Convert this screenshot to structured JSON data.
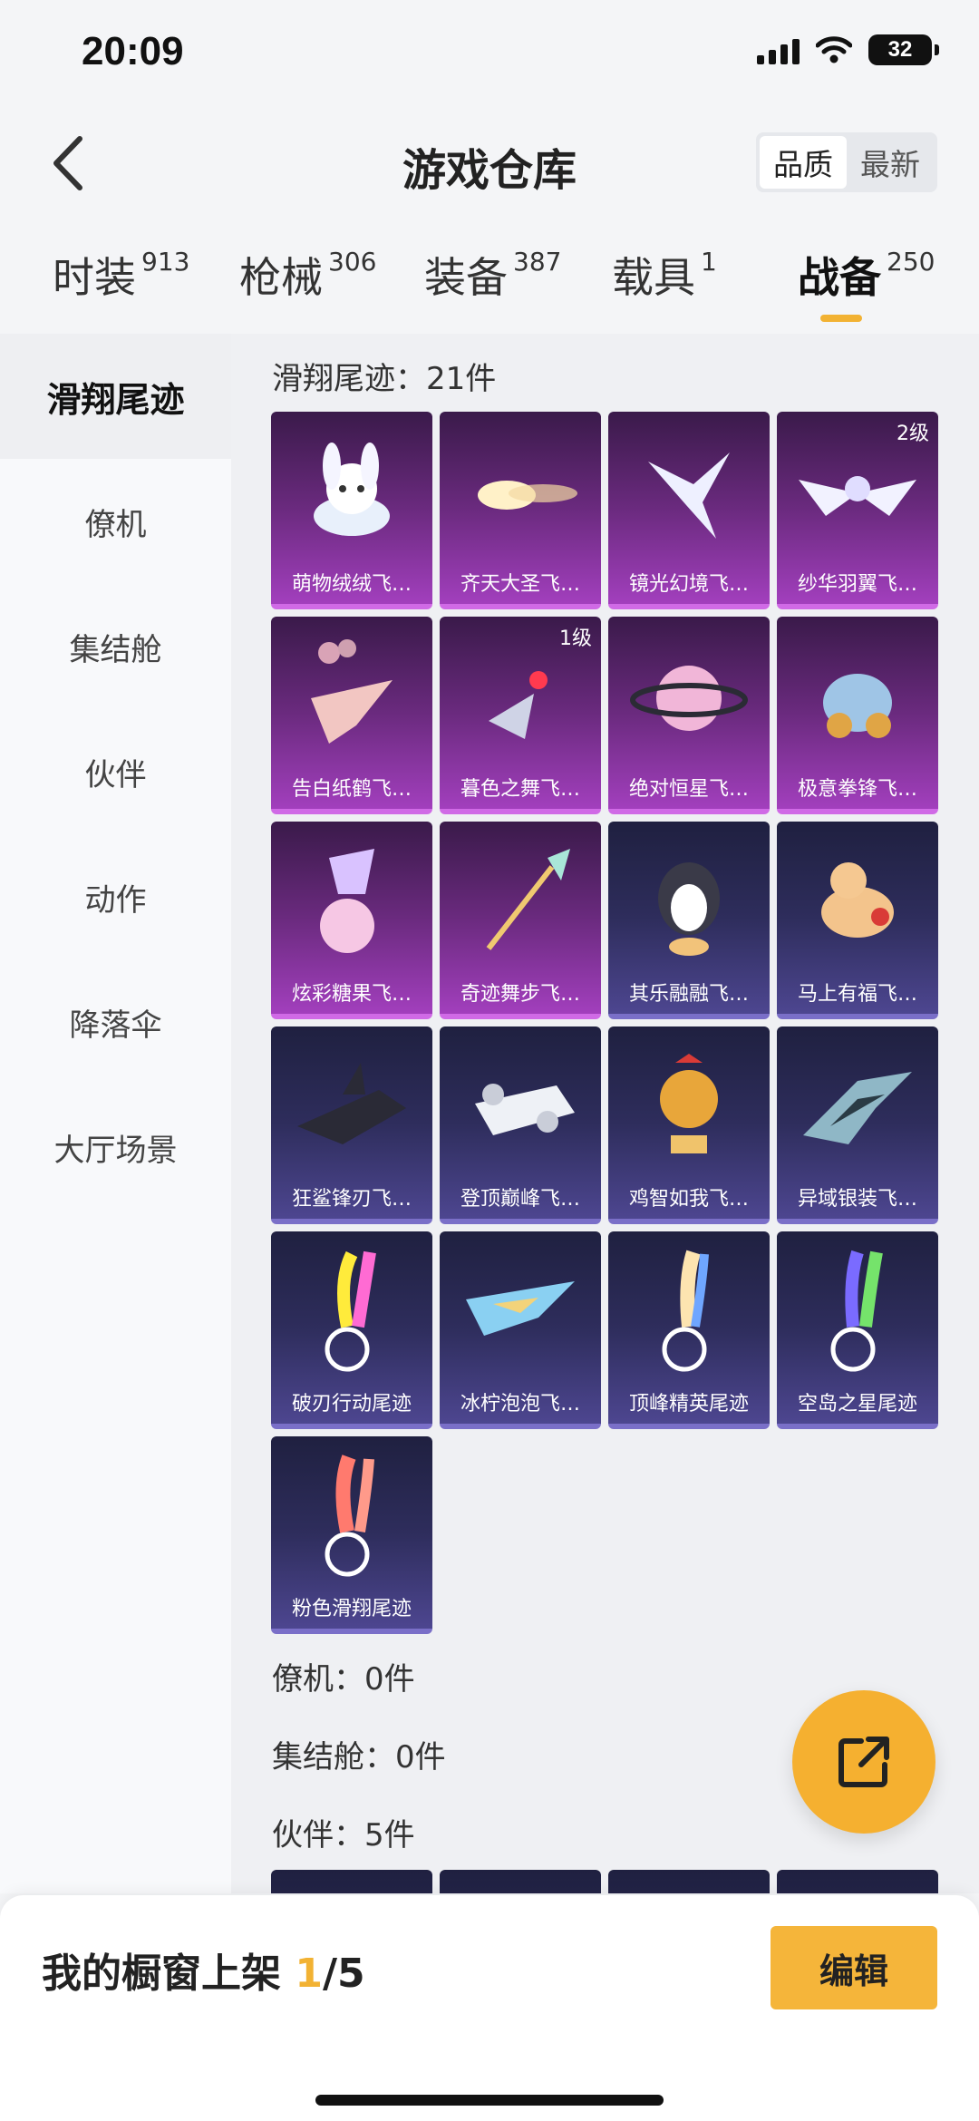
{
  "status": {
    "time": "20:09",
    "battery": "32"
  },
  "header": {
    "title": "游戏仓库",
    "sort_options": [
      "品质",
      "最新"
    ],
    "active_sort": "品质"
  },
  "tabs": [
    {
      "label": "时装",
      "count": "913"
    },
    {
      "label": "枪械",
      "count": "306"
    },
    {
      "label": "装备",
      "count": "387"
    },
    {
      "label": "载具",
      "count": "1"
    },
    {
      "label": "战备",
      "count": "250"
    }
  ],
  "sidebar": [
    "滑翔尾迹",
    "僚机",
    "集结舱",
    "伙伴",
    "动作",
    "降落伞",
    "大厅场景"
  ],
  "sections": {
    "glide": "滑翔尾迹：21件",
    "wingman": "僚机：0件",
    "pod": "集结舱：0件",
    "partner": "伙伴：5件"
  },
  "items": [
    {
      "name": "萌物绒绒飞…",
      "rarity": "purple",
      "icon": "plush-bunny-icon"
    },
    {
      "name": "齐天大圣飞…",
      "rarity": "purple",
      "icon": "cloud-comet-icon"
    },
    {
      "name": "镜光幻境飞…",
      "rarity": "purple",
      "icon": "crystal-wing-icon"
    },
    {
      "name": "纱华羽翼飞…",
      "rarity": "purple",
      "icon": "feather-wings-icon",
      "level": "2级"
    },
    {
      "name": "告白纸鹤飞…",
      "rarity": "purple",
      "icon": "paper-crane-icon"
    },
    {
      "name": "暮色之舞飞…",
      "rarity": "purple",
      "icon": "dusk-dance-icon",
      "level": "1级"
    },
    {
      "name": "绝对恒星飞…",
      "rarity": "purple",
      "icon": "planet-ring-icon"
    },
    {
      "name": "极意拳锋飞…",
      "rarity": "purple",
      "icon": "elephant-boxer-icon"
    },
    {
      "name": "炫彩糖果飞…",
      "rarity": "purple",
      "icon": "candy-icon"
    },
    {
      "name": "奇迹舞步飞…",
      "rarity": "purple",
      "icon": "magic-staff-icon"
    },
    {
      "name": "其乐融融飞…",
      "rarity": "blue",
      "icon": "penguin-icon"
    },
    {
      "name": "马上有福飞…",
      "rarity": "blue",
      "icon": "toy-horse-icon"
    },
    {
      "name": "狂鲨锋刃飞…",
      "rarity": "blue",
      "icon": "shark-jet-icon"
    },
    {
      "name": "登顶巅峰飞…",
      "rarity": "blue",
      "icon": "white-jet-icon"
    },
    {
      "name": "鸡智如我飞…",
      "rarity": "blue",
      "icon": "rooster-icon"
    },
    {
      "name": "异域银装飞…",
      "rarity": "blue",
      "icon": "silver-wing-icon"
    },
    {
      "name": "破刃行动尾迹",
      "rarity": "blue",
      "icon": "rainbow-trail-icon"
    },
    {
      "name": "冰柠泡泡飞…",
      "rarity": "blue",
      "icon": "lemon-plane-icon"
    },
    {
      "name": "顶峰精英尾迹",
      "rarity": "blue",
      "icon": "flame-trail-icon"
    },
    {
      "name": "空岛之星尾迹",
      "rarity": "blue",
      "icon": "star-trail-icon"
    },
    {
      "name": "粉色滑翔尾迹",
      "rarity": "blue",
      "icon": "pink-trail-icon"
    }
  ],
  "bottom": {
    "label_prefix": "我的橱窗上架 ",
    "current": "1",
    "total": "/5",
    "edit": "编辑"
  },
  "colors": {
    "accent": "#f2b233",
    "purple": "#a23fbd",
    "blue": "#4d4690"
  }
}
